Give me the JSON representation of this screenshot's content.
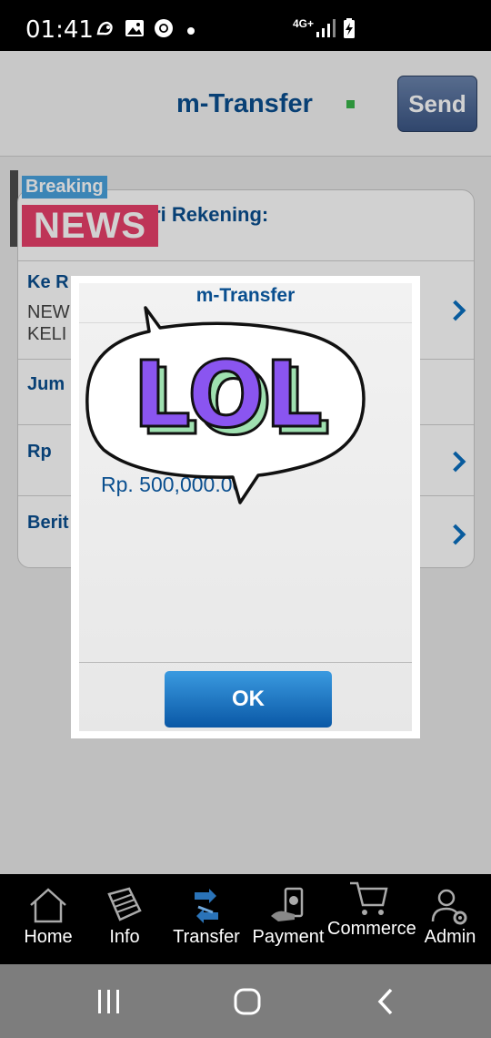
{
  "status_bar": {
    "time": "01:41",
    "network": "4G+",
    "icons": [
      "uc-browser-icon",
      "image-icon",
      "chrome-icon",
      "notification-dot-icon",
      "signal-icon",
      "battery-charging-icon"
    ]
  },
  "header": {
    "title": "m-Transfer",
    "send_label": "Send",
    "status_color": "#39b54a"
  },
  "form": {
    "from_label": "Dari Rekening:",
    "rows": [
      {
        "label": "Ke R",
        "sub1": "NEW",
        "sub2": "KELI"
      },
      {
        "label": "Jum"
      },
      {
        "label": "Rp"
      },
      {
        "label": "Berit"
      }
    ]
  },
  "badge": {
    "breaking": "Breaking",
    "news": "NEWS"
  },
  "dialog": {
    "title": "m-Transfer",
    "amount": "Rp. 500,000.00",
    "ok_label": "OK"
  },
  "sticker": {
    "text": "LOL"
  },
  "bottom_nav": {
    "items": [
      {
        "label": "Home",
        "icon": "home-icon"
      },
      {
        "label": "Info",
        "icon": "info-book-icon"
      },
      {
        "label": "Transfer",
        "icon": "transfer-icon"
      },
      {
        "label": "Payment",
        "icon": "payment-icon"
      },
      {
        "label": "Commerce",
        "icon": "cart-icon"
      },
      {
        "label": "Admin",
        "icon": "admin-icon"
      }
    ]
  },
  "colors": {
    "brand_blue": "#0a4f8f",
    "accent_pink": "#e8406b",
    "accent_cyan": "#4aa3df"
  }
}
